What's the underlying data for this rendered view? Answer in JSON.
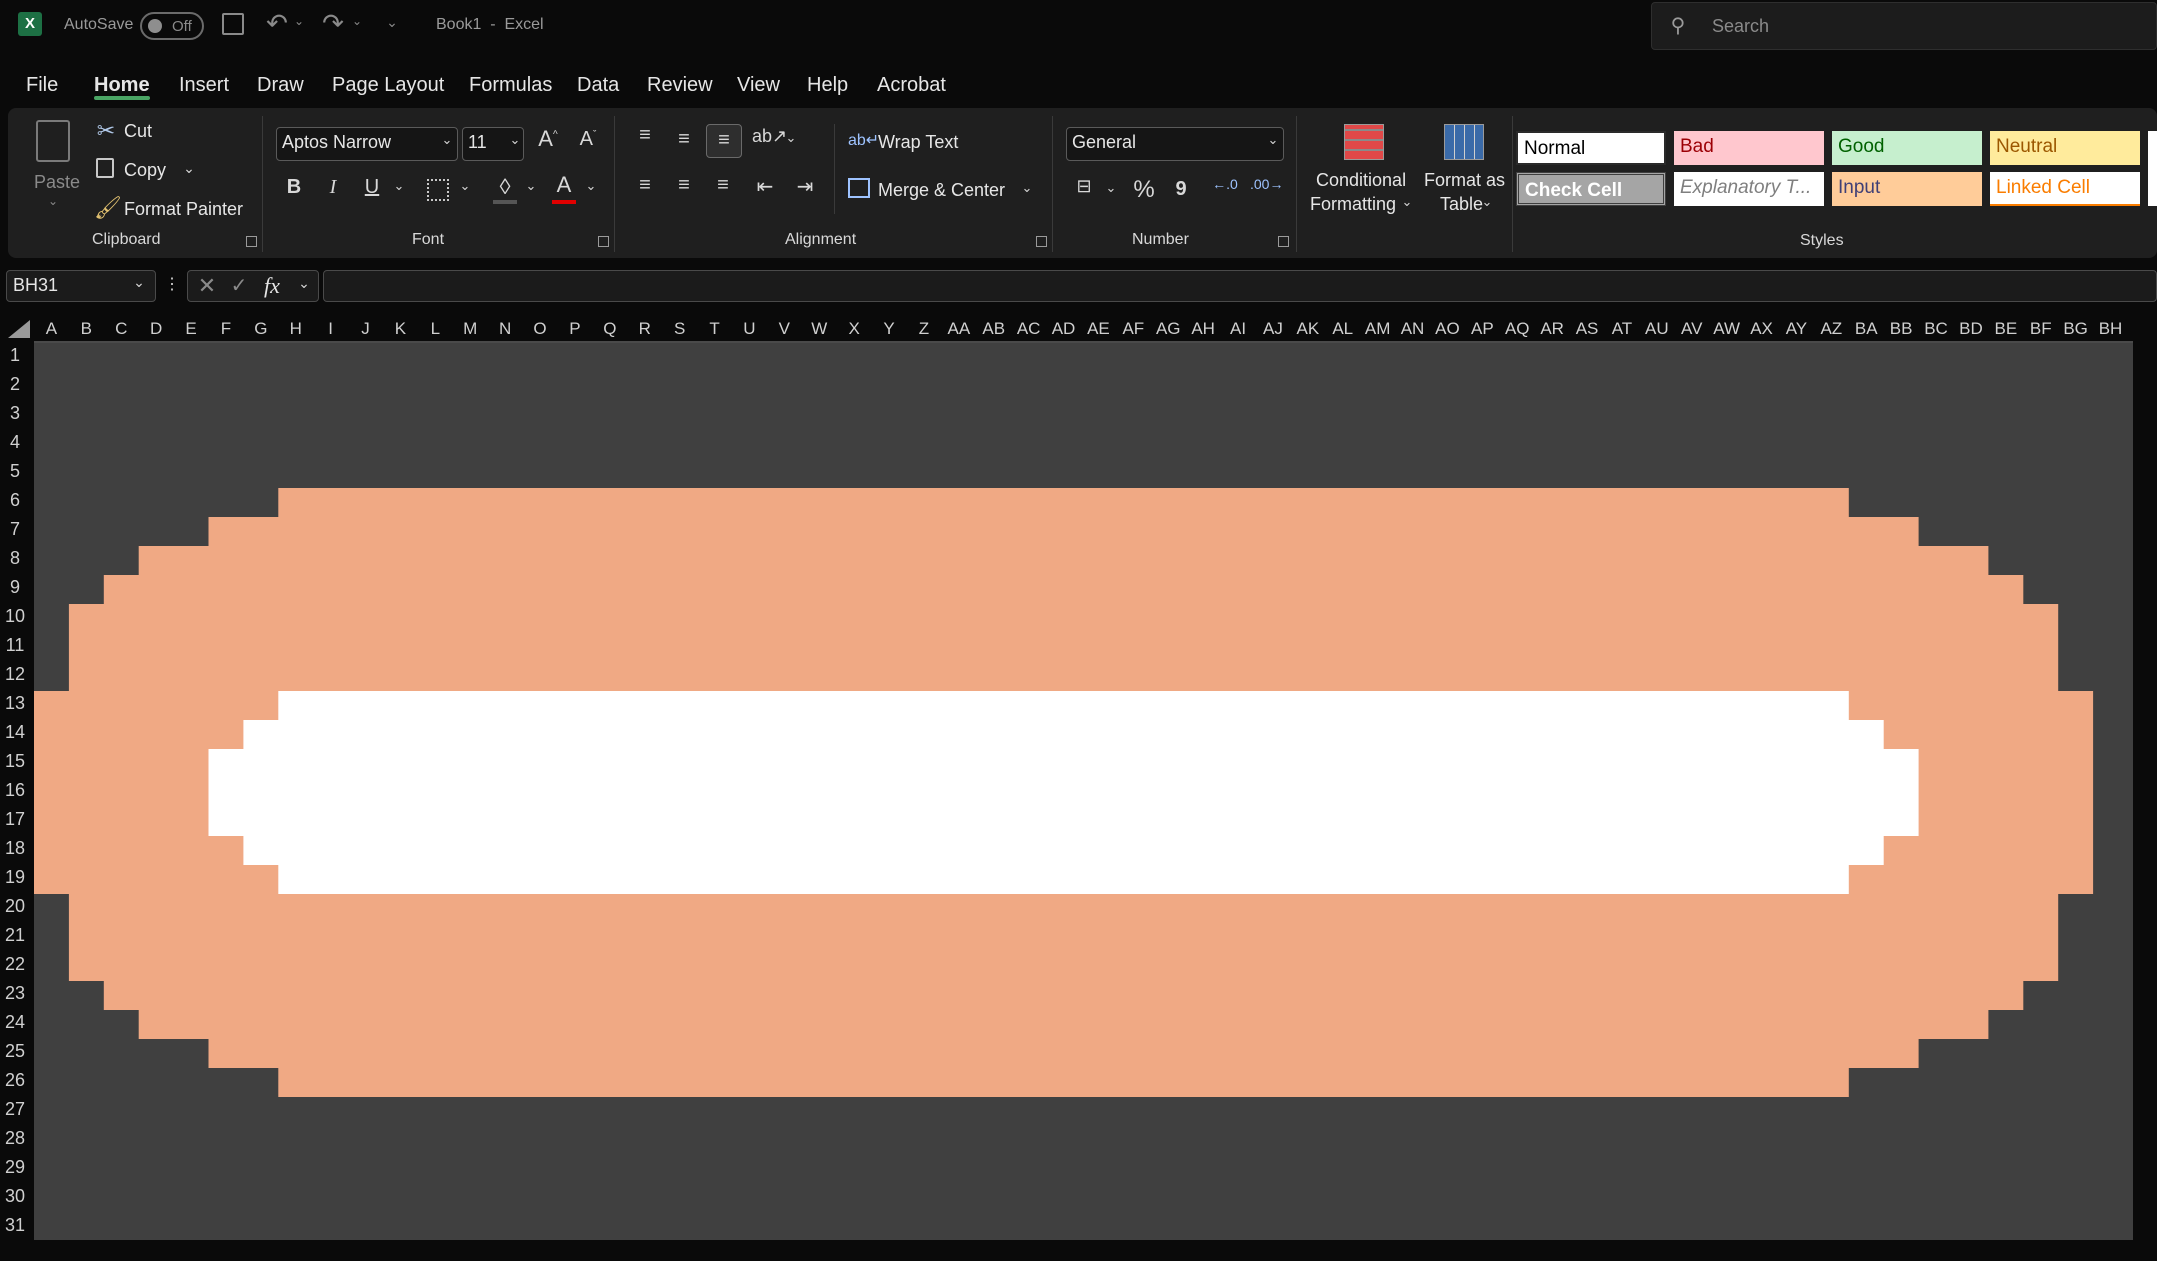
{
  "titlebar": {
    "autosave_label": "AutoSave",
    "autosave_state": "Off",
    "document_title": "Book1  -  Excel",
    "search_placeholder": "Search"
  },
  "menu": [
    "File",
    "Home",
    "Insert",
    "Draw",
    "Page Layout",
    "Formulas",
    "Data",
    "Review",
    "View",
    "Help",
    "Acrobat"
  ],
  "active_menu": "Home",
  "ribbon": {
    "clipboard": {
      "paste": "Paste",
      "cut": "Cut",
      "copy": "Copy",
      "format_painter": "Format Painter",
      "label": "Clipboard"
    },
    "font": {
      "name": "Aptos Narrow",
      "size": "11",
      "bold": "B",
      "italic": "I",
      "underline": "U",
      "label": "Font",
      "font_color": "#e00000"
    },
    "alignment": {
      "wrap": "Wrap Text",
      "merge": "Merge & Center",
      "label": "Alignment"
    },
    "number": {
      "format": "General",
      "percent": "%",
      "comma": "9",
      "label": "Number"
    },
    "styles_cmds": {
      "conditional_line1": "Conditional",
      "conditional_line2": "Formatting",
      "format_table_line1": "Format as",
      "format_table_line2": "Table"
    },
    "styles": {
      "label": "Styles",
      "items": [
        {
          "text": "Normal",
          "bg": "#ffffff",
          "fg": "#000000"
        },
        {
          "text": "Bad",
          "bg": "#ffc7ce",
          "fg": "#9c0006"
        },
        {
          "text": "Good",
          "bg": "#c6efce",
          "fg": "#006100"
        },
        {
          "text": "Neutral",
          "bg": "#ffeb9c",
          "fg": "#9c5700"
        },
        {
          "text": "Check Cell",
          "bg": "#a5a5a5",
          "fg": "#ffffff"
        },
        {
          "text": "Explanatory T...",
          "bg": "#ffffff",
          "fg": "#7f7f7f"
        },
        {
          "text": "Input",
          "bg": "#ffcc99",
          "fg": "#3f3f76"
        },
        {
          "text": "Linked Cell",
          "bg": "#ffffff",
          "fg": "#fa7d00"
        }
      ]
    }
  },
  "formula_bar": {
    "name_box": "BH31",
    "fx": "fx",
    "formula": ""
  },
  "columns": [
    "A",
    "B",
    "C",
    "D",
    "E",
    "F",
    "G",
    "H",
    "I",
    "J",
    "K",
    "L",
    "M",
    "N",
    "O",
    "P",
    "Q",
    "R",
    "S",
    "T",
    "U",
    "V",
    "W",
    "X",
    "Y",
    "Z",
    "AA",
    "AB",
    "AC",
    "AD",
    "AE",
    "AF",
    "AG",
    "AH",
    "AI",
    "AJ",
    "AK",
    "AL",
    "AM",
    "AN",
    "AO",
    "AP",
    "AQ",
    "AR",
    "AS",
    "AT",
    "AU",
    "AV",
    "AW",
    "AX",
    "AY",
    "AZ",
    "BA",
    "BB",
    "BC",
    "BD",
    "BE",
    "BF",
    "BG",
    "BH"
  ],
  "rows": [
    "1",
    "2",
    "3",
    "4",
    "5",
    "6",
    "7",
    "8",
    "9",
    "10",
    "11",
    "12",
    "13",
    "14",
    "15",
    "16",
    "17",
    "18",
    "19",
    "20",
    "21",
    "22",
    "23",
    "24",
    "25",
    "26",
    "27",
    "28",
    "29",
    "30",
    "31"
  ],
  "sheet_colors": {
    "background": "#404040",
    "outer_shape": "#f0a984",
    "inner_shape": "#ffffff"
  }
}
